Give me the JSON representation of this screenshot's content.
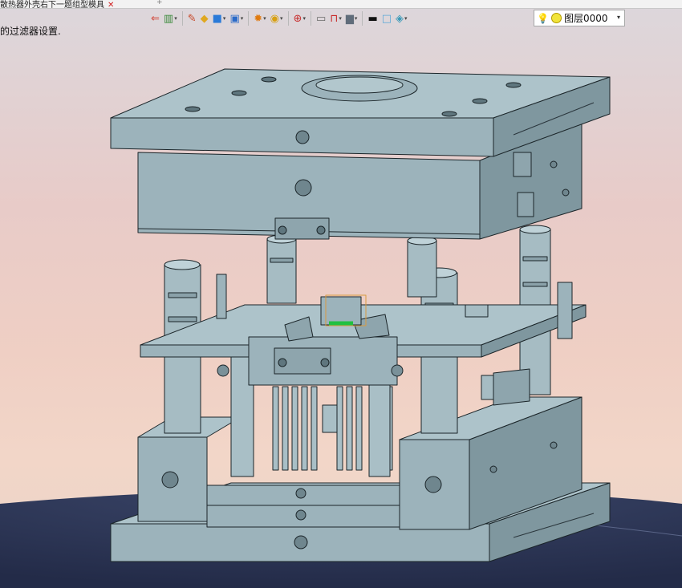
{
  "window": {
    "doc_tab_title": "散热器外壳右下一题组型模具",
    "close_glyph": "✕",
    "new_tab_glyph": "+"
  },
  "status_text": "的过滤器设置.",
  "toolbar": {
    "tools": [
      {
        "name": "exit-sketch-icon",
        "glyph": "⇐",
        "color": "#d24a3c"
      },
      {
        "name": "component-icon",
        "glyph": "▥",
        "color": "#3a8a3a",
        "dropdown": true
      },
      {
        "name": "edit-icon",
        "glyph": "✎",
        "color": "#c84a2a"
      },
      {
        "name": "extrude-icon",
        "glyph": "◆",
        "color": "#e0a820"
      },
      {
        "name": "solid-box-icon",
        "glyph": "■",
        "color": "#2a7ad8",
        "dropdown": true
      },
      {
        "name": "display-style-icon",
        "glyph": "▣",
        "color": "#2a6ac8",
        "dropdown": true
      },
      {
        "name": "hide-show-icon",
        "glyph": "✹",
        "color": "#e07a10",
        "dropdown": true
      },
      {
        "name": "appearance-icon",
        "glyph": "◉",
        "color": "#d8a010",
        "dropdown": true
      },
      {
        "name": "view-orient-icon",
        "glyph": "⊕",
        "color": "#c83030",
        "dropdown": true
      },
      {
        "name": "section-view-icon",
        "glyph": "▭",
        "color": "#6a6a6a"
      },
      {
        "name": "measure-icon",
        "glyph": "⊓",
        "color": "#c82828",
        "dropdown": true
      },
      {
        "name": "scene-icon",
        "glyph": "▆",
        "color": "#606c7a",
        "dropdown": true
      },
      {
        "name": "line-style-icon",
        "glyph": "▬",
        "color": "#111111"
      },
      {
        "name": "color-swatch-icon",
        "glyph": "□",
        "color": "#5aa8d8"
      },
      {
        "name": "layer-stack-icon",
        "glyph": "◈",
        "color": "#3a9ab8",
        "dropdown": true
      }
    ],
    "dropdown_glyph": "▾"
  },
  "layer": {
    "bulb_glyph": "💡",
    "value": "图层0000",
    "arrow_glyph": "▾"
  },
  "colors": {
    "mold_face": "#9cb3bb",
    "mold_light": "#adc3ca",
    "mold_dark": "#7f979f",
    "edge": "#1b2529",
    "floor": "#2c3657",
    "background": "#e9cfc8"
  }
}
